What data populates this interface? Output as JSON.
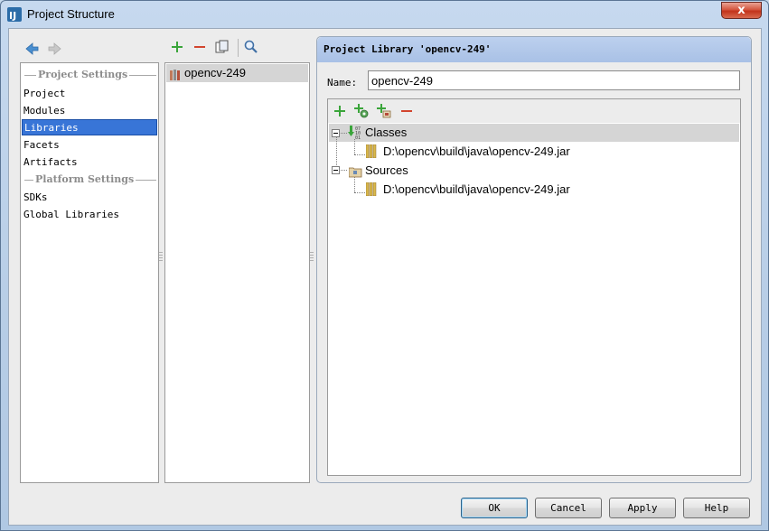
{
  "window": {
    "title": "Project Structure",
    "close_glyph": "x"
  },
  "nav": {
    "back_icon": "back-arrow-icon",
    "forward_icon": "forward-arrow-icon"
  },
  "sidebar": {
    "project_settings_header": "Project Settings",
    "platform_settings_header": "Platform Settings",
    "items": [
      {
        "label": "Project"
      },
      {
        "label": "Modules"
      },
      {
        "label": "Libraries",
        "selected": true
      },
      {
        "label": "Facets"
      },
      {
        "label": "Artifacts"
      },
      {
        "label": "SDKs"
      },
      {
        "label": "Global Libraries"
      }
    ]
  },
  "library_list": {
    "toolbar": [
      "add-icon",
      "remove-icon",
      "copy-icon",
      "find-icon"
    ],
    "items": [
      {
        "label": "opencv-249"
      }
    ]
  },
  "details": {
    "header": "Project Library 'opencv-249'",
    "name_label": "Name:",
    "name_value": "opencv-249",
    "tree_toolbar": [
      "add-icon",
      "add-classes-icon",
      "add-jar-icon",
      "remove-icon"
    ],
    "tree": {
      "classes": {
        "label": "Classes",
        "children": [
          "D:\\opencv\\build\\java\\opencv-249.jar"
        ]
      },
      "sources": {
        "label": "Sources",
        "children": [
          "D:\\opencv\\build\\java\\opencv-249.jar"
        ]
      }
    }
  },
  "buttons": {
    "ok": "OK",
    "cancel": "Cancel",
    "apply": "Apply",
    "help": "Help"
  },
  "colors": {
    "selection": "#3875d7",
    "header_blue": "#a9c1e6",
    "add_green": "#3aa53a",
    "remove_red": "#d2452e"
  }
}
